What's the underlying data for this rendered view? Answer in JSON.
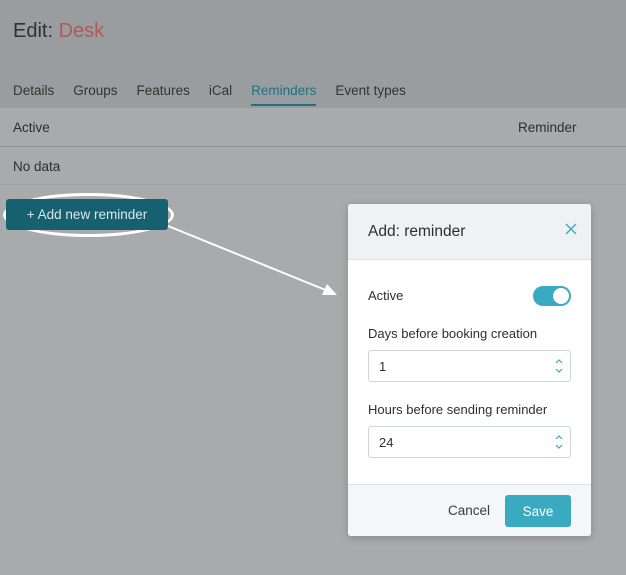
{
  "header": {
    "title_prefix": "Edit:",
    "title_entity": "Desk",
    "tabs": [
      {
        "label": "Details"
      },
      {
        "label": "Groups"
      },
      {
        "label": "Features"
      },
      {
        "label": "iCal"
      },
      {
        "label": "Reminders"
      },
      {
        "label": "Event types"
      }
    ],
    "active_tab": "Reminders"
  },
  "table": {
    "columns": [
      "Active",
      "Reminder"
    ],
    "empty_text": "No data"
  },
  "add_button": {
    "label": "+ Add new reminder"
  },
  "modal": {
    "title": "Add: reminder",
    "active_label": "Active",
    "active_value": true,
    "days_label": "Days before booking creation",
    "days_value": "1",
    "hours_label": "Hours before sending reminder",
    "hours_value": "24",
    "cancel_label": "Cancel",
    "save_label": "Save"
  },
  "colors": {
    "accent": "#3aaac0",
    "entity_title": "#b05a52",
    "add_button_bg": "#17606f"
  }
}
